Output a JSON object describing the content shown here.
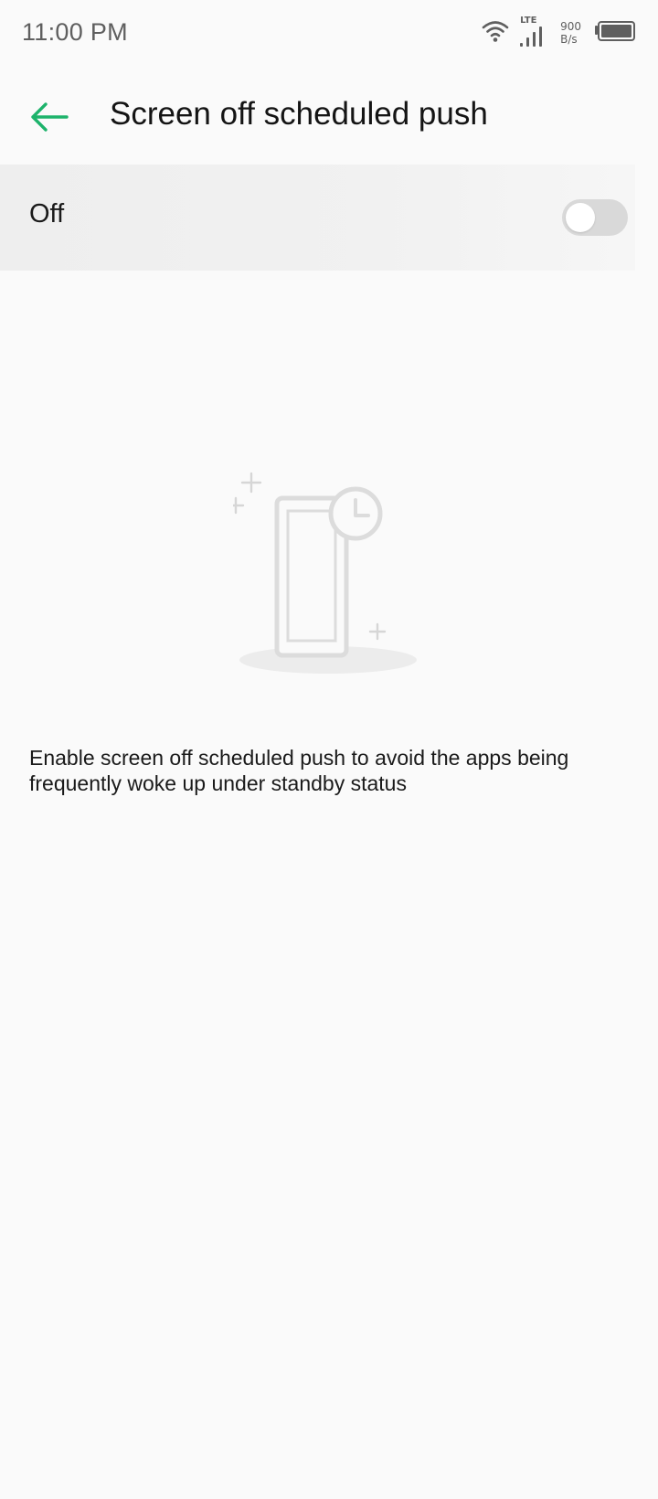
{
  "status_bar": {
    "time": "11:00 PM",
    "network_type": "LTE",
    "net_speed_value": "900",
    "net_speed_unit": "B/s",
    "icons": [
      "wifi-icon",
      "signal-icon",
      "battery-icon"
    ]
  },
  "app_bar": {
    "back_icon": "arrow-left-icon",
    "title": "Screen off scheduled push"
  },
  "toggle": {
    "label": "Off",
    "state": false
  },
  "empty_state": {
    "illustration": "phone-with-clock-illustration",
    "description": "Enable screen off scheduled push to avoid the apps being frequently woke up under standby status"
  },
  "colors": {
    "accent": "#1db36b",
    "background": "#fafafa",
    "toggle_track_off": "#d9d9d9",
    "illustration_gray": "#dcdcdc"
  }
}
